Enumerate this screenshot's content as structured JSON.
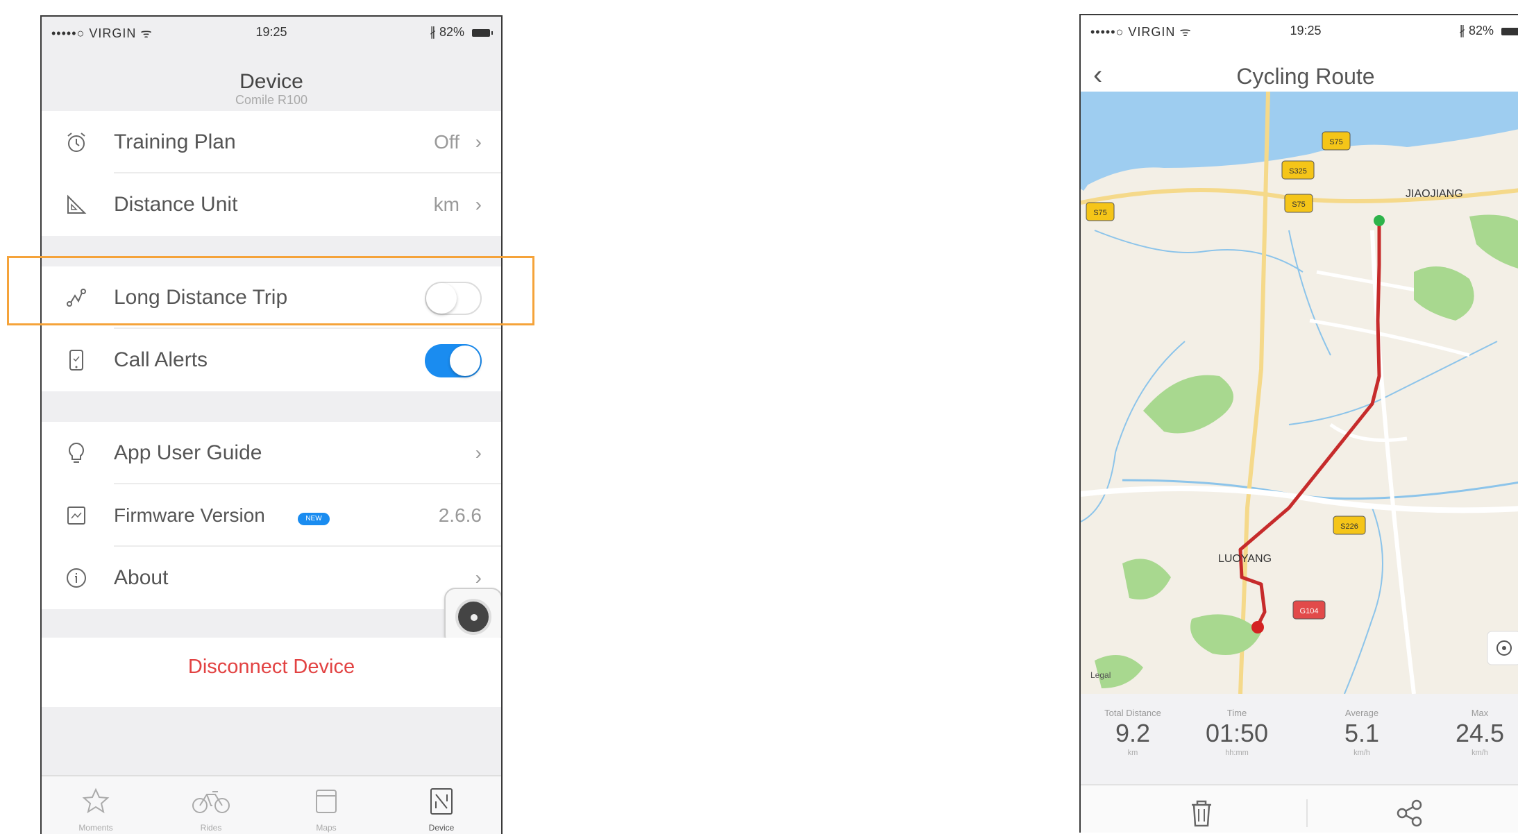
{
  "left": {
    "status": {
      "carrier": "•••••○ VIRGIN ᯤ",
      "time": "19:25",
      "battery": "∦ 82%"
    },
    "header": {
      "title": "Device",
      "subtitle": "Comile R100"
    },
    "settings": {
      "training_plan": {
        "label": "Training Plan",
        "value": "Off",
        "icon": "alarm-clock-icon"
      },
      "distance_unit": {
        "label": "Distance Unit",
        "value": "km",
        "icon": "ruler-triangle-icon"
      },
      "long_distance_trip": {
        "label": "Long Distance Trip",
        "enabled": false,
        "icon": "route-icon"
      },
      "call_alerts": {
        "label": "Call Alerts",
        "enabled": true,
        "icon": "phone-icon"
      },
      "app_user_guide": {
        "label": "App User Guide",
        "icon": "lightbulb-icon"
      },
      "firmware_version": {
        "label": "Firmware Version",
        "badge": "NEW",
        "value": "2.6.6",
        "icon": "firmware-icon"
      },
      "about": {
        "label": "About",
        "icon": "info-icon"
      }
    },
    "disconnect_label": "Disconnect Device",
    "tabs": [
      {
        "label": "Moments",
        "icon": "star-icon"
      },
      {
        "label": "Rides",
        "icon": "bicycle-icon"
      },
      {
        "label": "Maps",
        "icon": "maps-icon"
      },
      {
        "label": "Device",
        "icon": "device-icon",
        "active": true
      }
    ],
    "highlight_color": "#f5a33a",
    "accent_color": "#1a8cf0",
    "danger_color": "#e24242"
  },
  "right": {
    "status": {
      "carrier": "•••••○ VIRGIN ᯤ",
      "time": "19:25",
      "battery": "∦ 82%"
    },
    "header": {
      "title": "Cycling Route",
      "back": "‹"
    },
    "map": {
      "labels": {
        "jiaojiang": "JIAOJIANG",
        "luoyang": "LUOYANG",
        "legal": "Legal",
        "road_s75_a": "S75",
        "road_s75_b": "S75",
        "road_s75_c": "S75",
        "road_s325": "S325",
        "road_s226": "S226",
        "road_g104": "G104"
      }
    },
    "stats": {
      "distance": {
        "label": "Total Distance",
        "value": "9.2",
        "unit": "km"
      },
      "time": {
        "label": "Time",
        "value": "01:50",
        "unit": "hh:mm"
      },
      "average": {
        "label": "Average",
        "value": "5.1",
        "unit": "km/h"
      },
      "max": {
        "label": "Max",
        "value": "24.5",
        "unit": "km/h"
      }
    },
    "actions": {
      "delete": "trash-icon",
      "share": "share-icon"
    }
  }
}
